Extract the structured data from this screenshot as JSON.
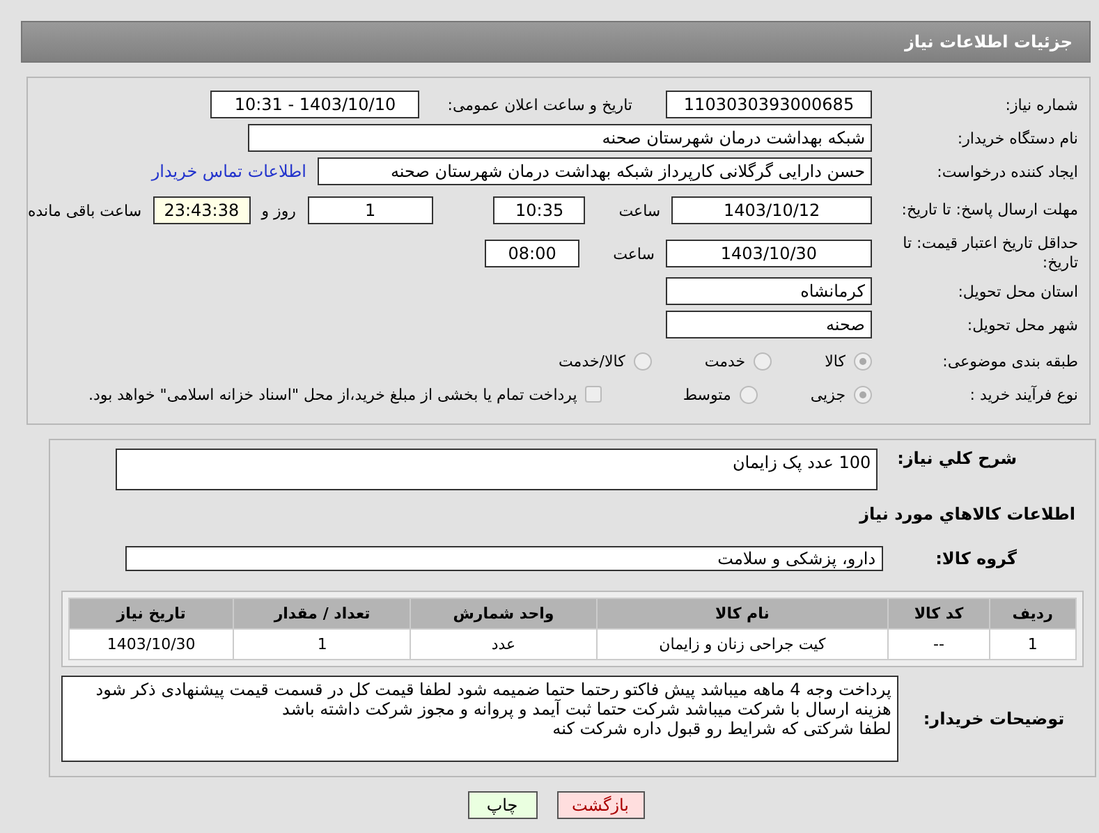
{
  "header": {
    "title": "جزئیات اطلاعات نیاز"
  },
  "summary": {
    "need_number": {
      "label": "شماره نیاز:",
      "value": "1103030393000685"
    },
    "announce": {
      "label": "تاریخ و ساعت اعلان عمومی:",
      "value": "1403/10/10 - 10:31"
    },
    "buyer_org": {
      "label": "نام دستگاه خریدار:",
      "value": "شبکه بهداشت درمان شهرستان صحنه"
    },
    "requester": {
      "label": "ایجاد کننده درخواست:",
      "value": "حسن دارایی گرگلانی کارپرداز شبکه بهداشت درمان شهرستان صحنه",
      "link": "اطلاعات تماس خریدار"
    },
    "reply_deadline": {
      "label": "مهلت ارسال پاسخ: تا تاریخ:",
      "date": "1403/10/12",
      "time_label": "ساعت",
      "time": "10:35",
      "days": "1",
      "days_label": "روز و",
      "remaining": "23:43:38",
      "remaining_label": "ساعت باقی مانده"
    },
    "price_validity": {
      "label": "حداقل تاریخ اعتبار قیمت: تا تاریخ:",
      "date": "1403/10/30",
      "time_label": "ساعت",
      "time": "08:00"
    },
    "province": {
      "label": "استان محل تحویل:",
      "value": "کرمانشاه"
    },
    "city": {
      "label": "شهر محل تحویل:",
      "value": "صحنه"
    },
    "category": {
      "label": "طبقه بندی موضوعی:",
      "options": [
        {
          "label": "کالا",
          "selected": true
        },
        {
          "label": "خدمت",
          "selected": false
        },
        {
          "label": "کالا/خدمت",
          "selected": false
        }
      ]
    },
    "purchase_type": {
      "label": "نوع فرآیند خرید :",
      "options": [
        {
          "label": "جزیی",
          "selected": true
        },
        {
          "label": "متوسط",
          "selected": false
        }
      ],
      "treasury": {
        "label": "پرداخت تمام یا بخشی از مبلغ خرید،از محل \"اسناد خزانه اسلامی\" خواهد بود.",
        "checked": false
      }
    }
  },
  "goods": {
    "description": {
      "label": "شرح کلي نياز:",
      "value": "100 عدد پک زایمان"
    },
    "heading": "اطلاعات کالاهاي مورد نياز",
    "group": {
      "label": "گروه کالا:",
      "value": "دارو، پزشکی و سلامت"
    },
    "table": {
      "columns": [
        "ردیف",
        "کد کالا",
        "نام کالا",
        "واحد شمارش",
        "تعداد / مقدار",
        "تاریخ نیاز"
      ],
      "rows": [
        [
          "1",
          "--",
          "کیت جراحی زنان و زایمان",
          "عدد",
          "1",
          "1403/10/30"
        ]
      ]
    },
    "buyer_notes": {
      "label": "توضیحات خریدار:",
      "lines": [
        "پرداخت وجه 4 ماهه  میباشد پیش فاکتو رحتما حتما ضمیمه شود لطفا قیمت کل در قسمت قیمت پیشنهادی ذکر شود",
        "هزینه ارسال با شرکت میباشد  شرکت حتما ثبت آیمد و پروانه و مجوز شرکت داشته باشد",
        "لطفا شرکتی که شرایط رو قبول داره شرکت کنه"
      ]
    }
  },
  "buttons": [
    {
      "label": "بازگشت",
      "kind": "back"
    },
    {
      "label": "چاپ",
      "kind": "print"
    }
  ]
}
